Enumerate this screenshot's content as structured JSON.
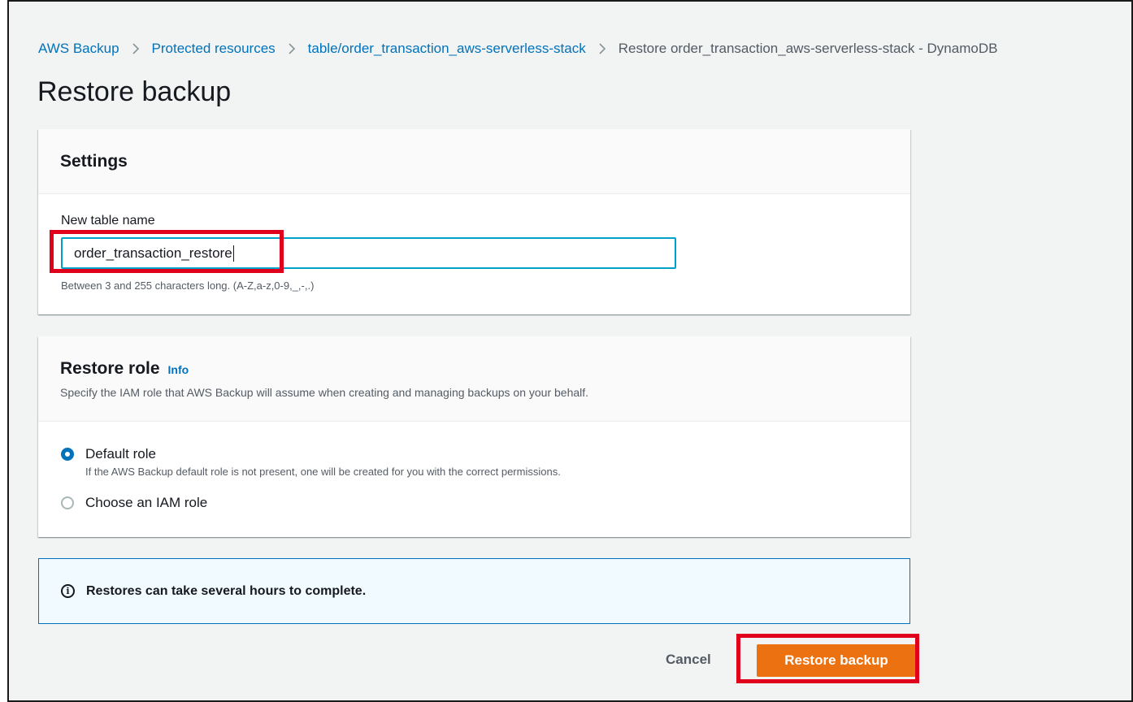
{
  "breadcrumb": {
    "items": [
      "AWS Backup",
      "Protected resources",
      "table/order_transaction_aws-serverless-stack"
    ],
    "current": "Restore order_transaction_aws-serverless-stack - DynamoDB",
    "separator_icon": "chevron-right-icon"
  },
  "page_title": "Restore backup",
  "settings": {
    "title": "Settings",
    "field_label": "New table name",
    "input_value": "order_transaction_restore",
    "hint": "Between 3 and 255 characters long. (A-Z,a-z,0-9,_,-,.)"
  },
  "restore_role": {
    "title": "Restore role",
    "info_link": "Info",
    "description": "Specify the IAM role that AWS Backup will assume when creating and managing backups on your behalf.",
    "options": [
      {
        "label": "Default role",
        "description": "If the AWS Backup default role is not present, one will be created for you with the correct permissions.",
        "selected": true
      },
      {
        "label": "Choose an IAM role",
        "description": "",
        "selected": false
      }
    ]
  },
  "alert": {
    "icon": "info-icon",
    "text": "Restores can take several hours to complete."
  },
  "actions": {
    "cancel_label": "Cancel",
    "restore_label": "Restore backup"
  },
  "colors": {
    "link": "#0073bb",
    "primary_button": "#ec7211",
    "highlight": "#e0001b",
    "input_focus": "#00a1c9",
    "alert_bg": "#f1faff"
  }
}
